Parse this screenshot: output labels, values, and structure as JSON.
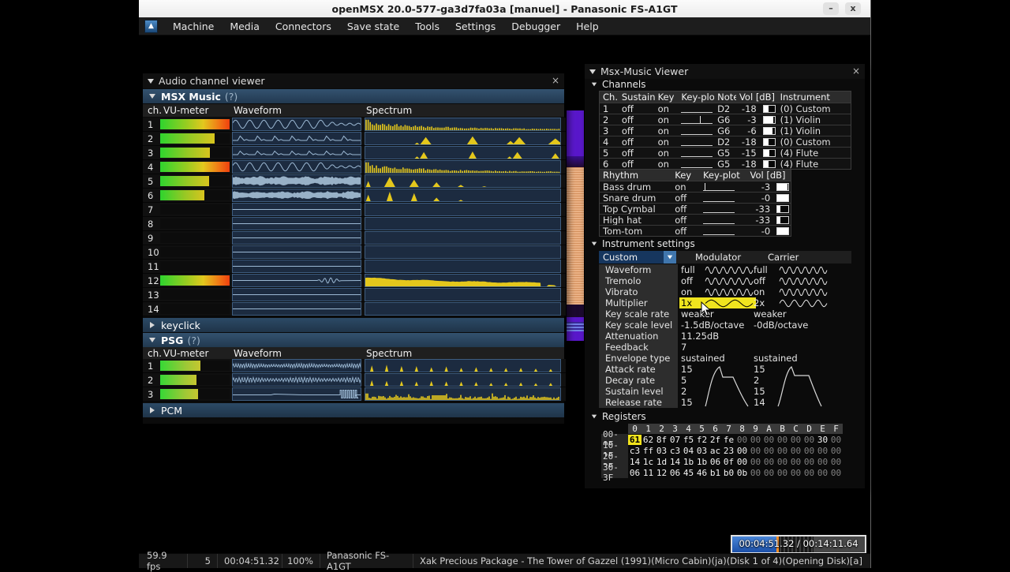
{
  "window": {
    "title": "openMSX 20.0-577-ga3d7fa03a [manuel] - Panasonic FS-A1GT",
    "minimize": "–",
    "close": "x"
  },
  "menu": {
    "items": [
      "Machine",
      "Media",
      "Connectors",
      "Save state",
      "Tools",
      "Settings",
      "Debugger",
      "Help"
    ]
  },
  "audio_viewer": {
    "title": "Audio channel viewer",
    "close": "×",
    "columns": [
      "ch.",
      "VU-meter",
      "Waveform",
      "Spectrum"
    ],
    "msx_music": {
      "label": "MSX Music",
      "hint": "(?)",
      "channels": [
        {
          "ch": "1",
          "vu": 1.0,
          "vu_style": "hot",
          "wave": "sine_fade",
          "spec": "comb_decay"
        },
        {
          "ch": "2",
          "vu": 0.78,
          "vu_style": "warm",
          "wave": "bumps",
          "spec": "peaks_a"
        },
        {
          "ch": "3",
          "vu": 0.72,
          "vu_style": "warm",
          "wave": "bumps_small",
          "spec": "peaks_b"
        },
        {
          "ch": "4",
          "vu": 1.0,
          "vu_style": "hot",
          "wave": "sine_fade",
          "spec": "comb_decay"
        },
        {
          "ch": "5",
          "vu": 0.7,
          "vu_style": "warm",
          "wave": "noise_band",
          "spec": "peaks_left"
        },
        {
          "ch": "6",
          "vu": 0.64,
          "vu_style": "warm",
          "wave": "noise_band2",
          "spec": "peaks_left2"
        },
        {
          "ch": "7",
          "vu": 0,
          "vu_style": "",
          "wave": "flat",
          "spec": "none"
        },
        {
          "ch": "8",
          "vu": 0,
          "vu_style": "",
          "wave": "flat",
          "spec": "none"
        },
        {
          "ch": "9",
          "vu": 0,
          "vu_style": "",
          "wave": "flat",
          "spec": "none"
        },
        {
          "ch": "10",
          "vu": 0,
          "vu_style": "",
          "wave": "flat",
          "spec": "none"
        },
        {
          "ch": "11",
          "vu": 0,
          "vu_style": "",
          "wave": "flat",
          "spec": "none"
        },
        {
          "ch": "12",
          "vu": 1.0,
          "vu_style": "hot",
          "wave": "flat_wiggle",
          "spec": "blob_decay"
        },
        {
          "ch": "13",
          "vu": 0,
          "vu_style": "",
          "wave": "flat",
          "spec": "none"
        },
        {
          "ch": "14",
          "vu": 0,
          "vu_style": "",
          "wave": "flat",
          "spec": "none"
        }
      ]
    },
    "keyclick_label": "keyclick",
    "psg": {
      "label": "PSG",
      "hint": "(?)",
      "channels": [
        {
          "ch": "1",
          "vu": 0.58,
          "vu_style": "psg",
          "wave": "hf_wave",
          "spec": "psg_comb"
        },
        {
          "ch": "2",
          "vu": 0.52,
          "vu_style": "psg",
          "wave": "hf_wave2",
          "spec": "psg_comb2"
        },
        {
          "ch": "3",
          "vu": 0.55,
          "vu_style": "psg",
          "wave": "flat_pulse",
          "spec": "psg_noise"
        }
      ]
    },
    "pcm_label": "PCM"
  },
  "msx_viewer": {
    "title": "Msx-Music Viewer",
    "close": "×",
    "channels_section": "Channels",
    "channels_table": {
      "headers": [
        "Ch.",
        "Sustain",
        "Key",
        "Key-plot",
        "Note",
        "Vol [dB]",
        "Instrument"
      ],
      "rows": [
        {
          "ch": "1",
          "sustain": "off",
          "key": "on",
          "tick": null,
          "note": "D2",
          "vol": "-18",
          "vol_fill": 0.42,
          "instrument": "(0) Custom"
        },
        {
          "ch": "2",
          "sustain": "off",
          "key": "on",
          "tick": 0.58,
          "note": "G6",
          "vol": "-3",
          "vol_fill": 0.9,
          "instrument": "(1) Violin"
        },
        {
          "ch": "3",
          "sustain": "off",
          "key": "on",
          "tick": null,
          "note": "G6",
          "vol": "-6",
          "vol_fill": 0.78,
          "instrument": "(1) Violin"
        },
        {
          "ch": "4",
          "sustain": "off",
          "key": "on",
          "tick": null,
          "note": "D2",
          "vol": "-18",
          "vol_fill": 0.42,
          "instrument": "(0) Custom"
        },
        {
          "ch": "5",
          "sustain": "off",
          "key": "on",
          "tick": null,
          "note": "G5",
          "vol": "-15",
          "vol_fill": 0.52,
          "instrument": "(4) Flute"
        },
        {
          "ch": "6",
          "sustain": "off",
          "key": "on",
          "tick": null,
          "note": "G5",
          "vol": "-18",
          "vol_fill": 0.42,
          "instrument": "(4) Flute"
        }
      ]
    },
    "rhythm_table": {
      "headers": [
        "Rhythm",
        "Key",
        "Key-plot",
        "Vol [dB]"
      ],
      "rows": [
        {
          "name": "Bass drum",
          "key": "on",
          "tick": 0.04,
          "vol": "-3",
          "vol_fill": 0.95
        },
        {
          "name": "Snare drum",
          "key": "off",
          "tick": null,
          "vol": "-0",
          "vol_fill": 1.0
        },
        {
          "name": "Top Cymbal",
          "key": "off",
          "tick": null,
          "vol": "-33",
          "vol_fill": 0.26
        },
        {
          "name": "High hat",
          "key": "off",
          "tick": null,
          "vol": "-33",
          "vol_fill": 0.26
        },
        {
          "name": "Tom-tom",
          "key": "off",
          "tick": null,
          "vol": "-0",
          "vol_fill": 1.0
        }
      ]
    },
    "instrument_section": "Instrument settings",
    "instrument": {
      "preset": "Custom",
      "col_mod": "Modulator",
      "col_car": "Carrier",
      "rows": [
        {
          "label": "Waveform",
          "mod": "full",
          "car": "full",
          "mod_icon": "sine6",
          "car_icon": "sine6"
        },
        {
          "label": "Tremolo",
          "mod": "off",
          "car": "off",
          "mod_icon": "sine6",
          "car_icon": "sine6"
        },
        {
          "label": "Vibrato",
          "mod": "on",
          "car": "on",
          "mod_icon": "sine6",
          "car_icon": "sine6"
        },
        {
          "label": "Multiplier",
          "mod": "1x",
          "car": "2x",
          "mod_icon": "sine2",
          "car_icon": "sine4",
          "highlight": "mod"
        },
        {
          "label": "Key scale rate",
          "mod": "weaker",
          "car": "weaker"
        },
        {
          "label": "Key scale level",
          "mod": "-1.5dB/octave",
          "car": "-0dB/octave"
        },
        {
          "label": "Attenuation",
          "mod": "11.25dB",
          "car": ""
        },
        {
          "label": "Feedback",
          "mod": "7",
          "car": ""
        },
        {
          "label": "Envelope type",
          "mod": "sustained",
          "car": "sustained"
        },
        {
          "label": "Attack rate",
          "mod": "15",
          "car": "15"
        },
        {
          "label": "Decay rate",
          "mod": "5",
          "car": "2"
        },
        {
          "label": "Sustain level",
          "mod": "2",
          "car": "15"
        },
        {
          "label": "Release rate",
          "mod": "15",
          "car": "14"
        }
      ]
    },
    "registers_section": "Registers",
    "registers": {
      "cols": [
        "0",
        "1",
        "2",
        "3",
        "4",
        "5",
        "6",
        "7",
        "8",
        "9",
        "A",
        "B",
        "C",
        "D",
        "E",
        "F"
      ],
      "rows": [
        {
          "label": "00-0F",
          "values": [
            "61",
            "62",
            "8f",
            "07",
            "f5",
            "f2",
            "2f",
            "fe",
            "00",
            "00",
            "00",
            "00",
            "00",
            "00",
            "30",
            "00"
          ],
          "bright": [
            1,
            1,
            1,
            1,
            1,
            1,
            1,
            1,
            0,
            0,
            0,
            0,
            0,
            0,
            1,
            0
          ],
          "highlight_col": 0
        },
        {
          "label": "10-1F",
          "values": [
            "c3",
            "ff",
            "03",
            "c3",
            "04",
            "03",
            "ac",
            "23",
            "00",
            "00",
            "00",
            "00",
            "00",
            "00",
            "00",
            "00"
          ],
          "bright": [
            1,
            1,
            1,
            1,
            1,
            1,
            1,
            1,
            1,
            0,
            0,
            0,
            0,
            0,
            0,
            0
          ]
        },
        {
          "label": "20-2F",
          "values": [
            "14",
            "1c",
            "1d",
            "14",
            "1b",
            "1b",
            "06",
            "0f",
            "00",
            "00",
            "00",
            "00",
            "00",
            "00",
            "00",
            "00"
          ],
          "bright": [
            1,
            1,
            1,
            1,
            1,
            1,
            1,
            1,
            1,
            0,
            0,
            0,
            0,
            0,
            0,
            0
          ]
        },
        {
          "label": "30-3F",
          "values": [
            "06",
            "11",
            "12",
            "06",
            "45",
            "46",
            "b1",
            "b0",
            "0b",
            "00",
            "00",
            "00",
            "00",
            "00",
            "00",
            "00"
          ],
          "bright": [
            1,
            1,
            1,
            1,
            1,
            1,
            1,
            1,
            1,
            0,
            0,
            0,
            0,
            0,
            0,
            0
          ]
        }
      ]
    }
  },
  "progress": {
    "text": "00:04:51.32 / 00:14:11.64",
    "fraction": 0.335
  },
  "statusbar": {
    "fps": "59.9 fps",
    "speed": "5",
    "time": "00:04:51.32",
    "percent": "100%",
    "machine": "Panasonic FS-A1GT",
    "media": "Xak Precious Package - The Tower of Gazzel (1991)(Micro Cabin)(ja)(Disk 1 of 4)(Opening Disk)[a]"
  }
}
